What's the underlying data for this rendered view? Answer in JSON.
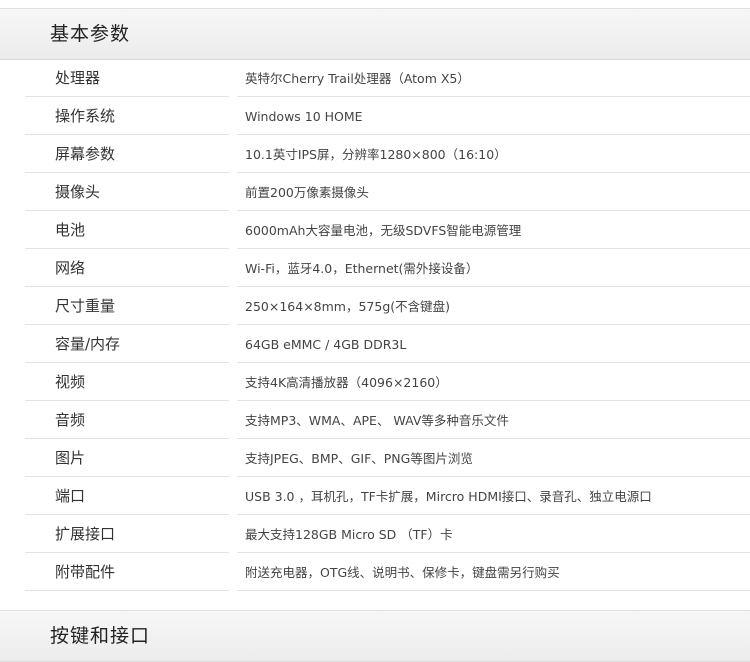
{
  "sections": {
    "basic_title": "基本参数",
    "keys_title": "按键和接口"
  },
  "specs": [
    {
      "label": "处理器",
      "value": "英特尔Cherry Trail处理器（Atom X5）"
    },
    {
      "label": "操作系统",
      "value": "Windows 10 HOME"
    },
    {
      "label": "屏幕参数",
      "value": "10.1英寸IPS屏，分辨率1280×800（16:10）"
    },
    {
      "label": "摄像头",
      "value": "前置200万像素摄像头"
    },
    {
      "label": "电池",
      "value": "6000mAh大容量电池，无级SDVFS智能电源管理"
    },
    {
      "label": "网络",
      "value": "Wi-Fi，蓝牙4.0，Ethernet(需外接设备）"
    },
    {
      "label": "尺寸重量",
      "value": "250×164×8mm，575g(不含键盘)"
    },
    {
      "label": "容量/内存",
      "value": "64GB eMMC  /   4GB DDR3L"
    },
    {
      "label": "视频",
      "value": "支持4K高清播放器（4096×2160）"
    },
    {
      "label": "音频",
      "value": "支持MP3、WMA、APE、 WAV等多种音乐文件"
    },
    {
      "label": "图片",
      "value": "支持JPEG、BMP、GIF、PNG等图片浏览"
    },
    {
      "label": "端口",
      "value": "USB 3.0 ，耳机孔，TF卡扩展，Mircro HDMI接口、录音孔、独立电源口"
    },
    {
      "label": "扩展接口",
      "value": "最大支持128GB Micro SD （TF）卡"
    },
    {
      "label": "附带配件",
      "value": "附送充电器，OTG线、说明书、保修卡，键盘需另行购买"
    }
  ]
}
